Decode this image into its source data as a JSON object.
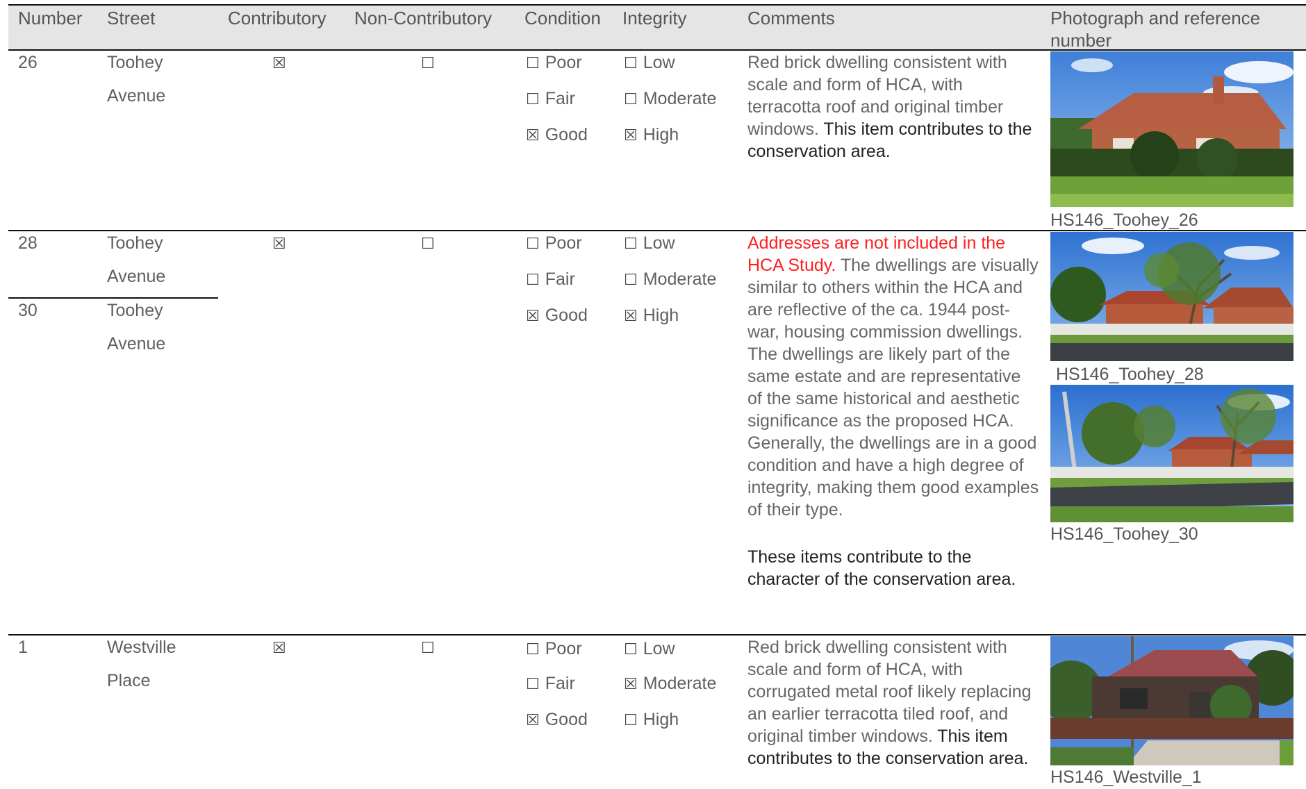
{
  "header": {
    "number": "Number",
    "street": "Street",
    "contributory": "Contributory",
    "non_contributory": "Non-Contributory",
    "condition": "Condition",
    "integrity": "Integrity",
    "comments": "Comments",
    "photo": "Photograph and reference number"
  },
  "glyphs": {
    "checked": "☒",
    "unchecked": "☐"
  },
  "options": {
    "condition": [
      "Poor",
      "Fair",
      "Good"
    ],
    "integrity": [
      "Low",
      "Moderate",
      "High"
    ]
  },
  "rows": [
    {
      "number": "26",
      "street_line1": "Toohey",
      "street_line2": "Avenue",
      "contributory": true,
      "non_contributory": false,
      "condition": "Good",
      "integrity": "High",
      "comment_plain": "Red brick dwelling consistent with scale and form of HCA, with terracotta roof and original timber windows.",
      "comment_emph": "This item contributes to the conservation area.",
      "caption": "HS146_Toohey_26"
    },
    {
      "number": "28",
      "street_line1": "Toohey",
      "street_line2": "Avenue",
      "number_b": "30",
      "street_b_line1": "Toohey",
      "street_b_line2": "Avenue",
      "contributory": true,
      "non_contributory": false,
      "condition": "Good",
      "integrity": "High",
      "comment_red": "Addresses are not included in the HCA Study.",
      "comment_plain": "The dwellings are visually similar to others within the HCA and are reflective of the ca. 1944 post-war, housing commission dwellings. The dwellings are likely part of the same estate and are representative of the same historical and aesthetic significance as the proposed HCA. Generally, the dwellings are in a good condition and have a high degree of integrity, making them good examples of their type.",
      "comment_emph": "These items contribute to the character of the conservation area.",
      "caption": "HS146_Toohey_28",
      "caption_b": "HS146_Toohey_30"
    },
    {
      "number": "1",
      "street_line1": "Westville",
      "street_line2": "Place",
      "contributory": true,
      "non_contributory": false,
      "condition": "Good",
      "integrity": "Moderate",
      "comment_plain": "Red brick dwelling consistent with scale and form of HCA, with corrugated metal roof likely replacing an earlier terracotta tiled roof, and original timber windows.",
      "comment_emph": "This item contributes to the conservation area.",
      "caption": "HS146_Westville_1"
    }
  ]
}
